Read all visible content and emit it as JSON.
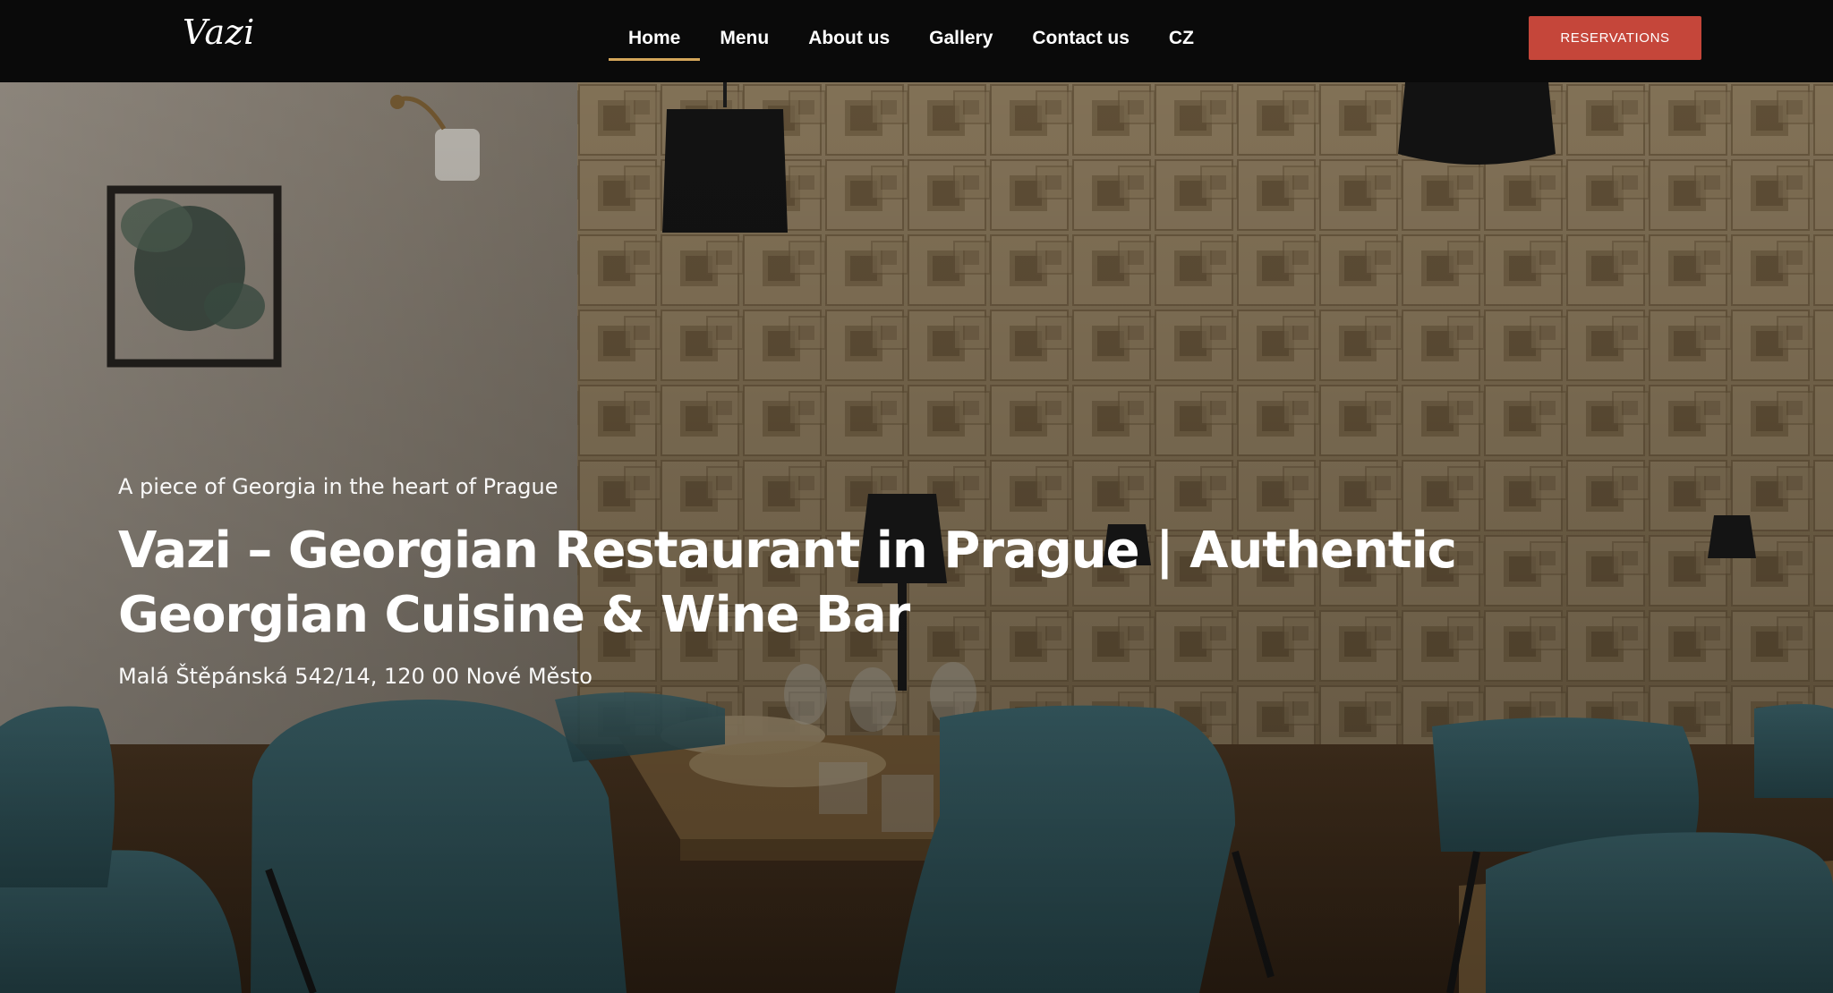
{
  "header": {
    "logo_text": "Vazi",
    "nav": [
      {
        "label": "Home",
        "active": true
      },
      {
        "label": "Menu",
        "active": false
      },
      {
        "label": "About us",
        "active": false
      },
      {
        "label": "Gallery",
        "active": false
      },
      {
        "label": "Contact us",
        "active": false
      },
      {
        "label": "CZ",
        "active": false
      }
    ],
    "reservations_label": "RESERVATIONS"
  },
  "hero": {
    "tagline": "A piece of Georgia in the heart of Prague",
    "title": "Vazi – Georgian Restaurant in Prague | Authentic Georgian Cuisine & Wine Bar",
    "address": "Malá Štěpánská 542/14, 120 00 Nové Město"
  },
  "colors": {
    "nav_background": "#0a0a0a",
    "active_underline": "#d4a65a",
    "reservations_button": "#c5463a",
    "text": "#ffffff",
    "wall_panel": "#9c8662",
    "chair_teal": "#3f6b73",
    "table_wood": "#8a6a40"
  }
}
